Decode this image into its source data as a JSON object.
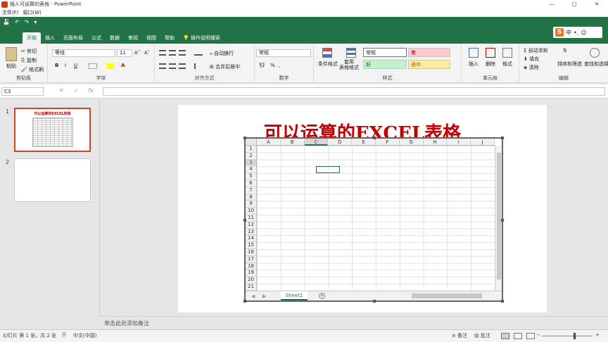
{
  "window": {
    "title": "插入可运算的表格 - PowerPoint",
    "controls": [
      "—",
      "□",
      "✕"
    ]
  },
  "menubar": [
    "文件(F)",
    "窗口(W)"
  ],
  "quick_access": [
    "💾",
    "↶",
    "↷",
    "▾"
  ],
  "tabs": [
    "开始",
    "插入",
    "页面布局",
    "公式",
    "数据",
    "审阅",
    "视图",
    "帮助",
    "操作说明搜索"
  ],
  "active_tab": "开始",
  "ime": {
    "logo": "S",
    "mode": "中",
    "punct": "•,",
    "emoji": "☺"
  },
  "ribbon": {
    "clipboard": {
      "label": "剪贴板",
      "paste": "粘贴",
      "cut": "剪切",
      "copy": "复制",
      "format_painter": "格式刷"
    },
    "font": {
      "label": "字体",
      "name": "等线",
      "size": "11",
      "grow": "A˄",
      "shrink": "A˅",
      "bold": "B",
      "italic": "I",
      "underline": "U",
      "font_color": "A"
    },
    "alignment": {
      "label": "对齐方式",
      "wrap": "自动换行",
      "merge": "合并后居中"
    },
    "number": {
      "label": "数字",
      "format": "常规",
      "percent": "%",
      "comma": ","
    },
    "styles": {
      "label": "样式",
      "cond_format": "条件格式",
      "table_format": "套用\n表格格式",
      "normal": "常规",
      "bad": "差",
      "good": "好",
      "neutral": "适中"
    },
    "cells": {
      "label": "单元格",
      "insert": "插入",
      "delete": "删除",
      "format": "格式"
    },
    "editing": {
      "label": "编辑",
      "autosum": "自动求和",
      "fill": "填充",
      "clear": "清除",
      "sort": "排序和筛选",
      "find": "查找和选择"
    }
  },
  "formula_bar": {
    "name_box": "C3",
    "cancel": "✕",
    "enter": "✓",
    "fx": "fx",
    "formula": ""
  },
  "slides": [
    {
      "number": "1",
      "thumb_title": "可以运算的EXCEL表格"
    },
    {
      "number": "2"
    }
  ],
  "slide": {
    "title": "可以运算的EXCEL表格"
  },
  "sheet": {
    "columns": [
      "A",
      "B",
      "C",
      "D",
      "E",
      "F",
      "G",
      "H",
      "I",
      "J"
    ],
    "rows": [
      "1",
      "2",
      "3",
      "4",
      "5",
      "6",
      "7",
      "8",
      "9",
      "10",
      "11",
      "12",
      "13",
      "14",
      "15",
      "16",
      "17",
      "18",
      "19",
      "20",
      "21"
    ],
    "selected_cell": "C3",
    "tab_name": "Sheet1",
    "add_sheet": "+"
  },
  "notes_placeholder": "单击此处添加备注",
  "status": {
    "slide_info": "幻灯片 第 1 张，共 2 张",
    "language": "中文(中国)",
    "notes": "备注",
    "comments": "批注"
  },
  "colors": {
    "accent": "#217346",
    "title_red": "#c00000",
    "selected_thumb": "#d04423"
  }
}
